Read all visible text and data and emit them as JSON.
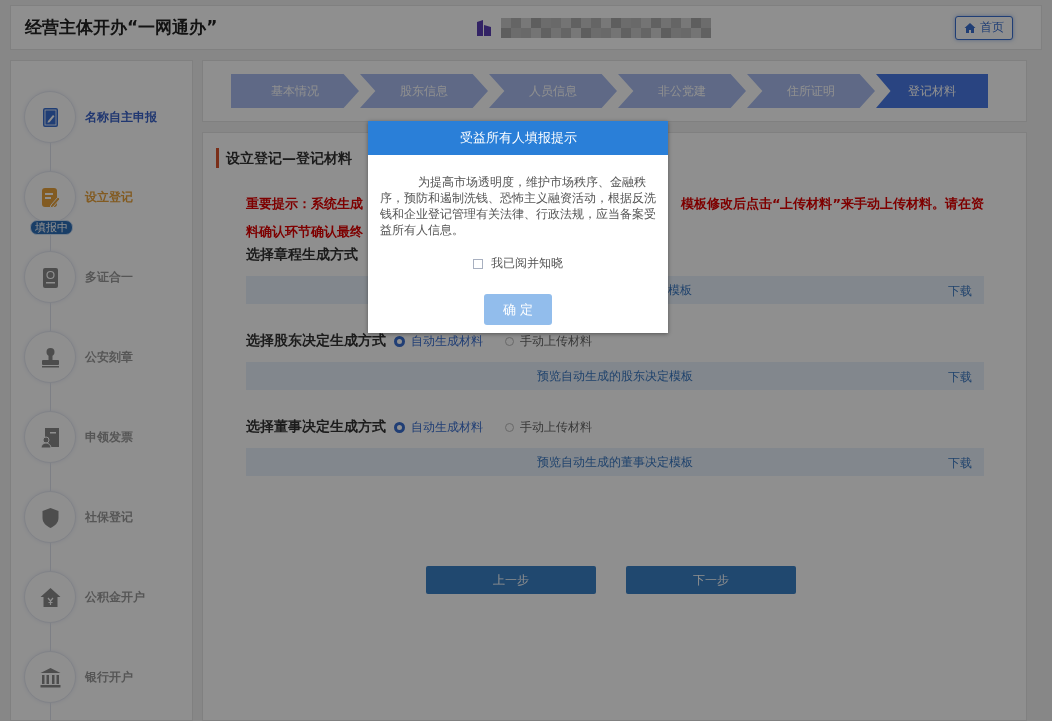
{
  "header": {
    "title": "经营主体开办“一网通办”",
    "home_button": "首页"
  },
  "sidebar": {
    "items": [
      {
        "label": "名称自主申报",
        "completed": true,
        "selected": false
      },
      {
        "label": "设立登记",
        "completed": false,
        "selected": true,
        "badge": "填报中"
      },
      {
        "label": "多证合一",
        "completed": false,
        "selected": false
      },
      {
        "label": "公安刻章",
        "completed": false,
        "selected": false
      },
      {
        "label": "申领发票",
        "completed": false,
        "selected": false
      },
      {
        "label": "社保登记",
        "completed": false,
        "selected": false
      },
      {
        "label": "公积金开户",
        "completed": false,
        "selected": false
      },
      {
        "label": "银行开户",
        "completed": false,
        "selected": false
      }
    ]
  },
  "steps": [
    {
      "label": "基本情况",
      "selected": false
    },
    {
      "label": "股东信息",
      "selected": false
    },
    {
      "label": "人员信息",
      "selected": false
    },
    {
      "label": "非公党建",
      "selected": false
    },
    {
      "label": "住所证明",
      "selected": false
    },
    {
      "label": "登记材料",
      "selected": true
    }
  ],
  "main": {
    "title": "设立登记—登记材料",
    "notice_lines": [
      {
        "start": "重要提示：系统生成",
        "end": "模板修改后点击“上传材料”来手动上传材料。请在资"
      },
      {
        "start": "料确认环节确认最终"
      }
    ],
    "sections": [
      {
        "label": "选择章程生成方式",
        "template": {
          "text": "模板",
          "download": "下载"
        }
      },
      {
        "label": "选择股东决定生成方式",
        "options": [
          {
            "label": "自动生成材料",
            "selected": true
          },
          {
            "label": "手动上传材料",
            "selected": false
          }
        ],
        "template": {
          "text": "预览自动生成的股东决定模板",
          "download": "下载"
        }
      },
      {
        "label": "选择董事决定生成方式",
        "options": [
          {
            "label": "自动生成材料",
            "selected": true
          },
          {
            "label": "手动上传材料",
            "selected": false
          }
        ],
        "template": {
          "text": "预览自动生成的董事决定模板",
          "download": "下载"
        }
      }
    ],
    "buttons": [
      "上一步",
      "下一步"
    ]
  },
  "dialog": {
    "title": "受益所有人填报提示",
    "message": "为提高市场透明度，维护市场秩序、金融秩序，预防和遏制洗钱、恐怖主义融资活动，根据反洗钱和企业登记管理有关法律、行政法规，应当备案受益所有人信息。",
    "checkbox": {
      "label": "我已阅并知晓",
      "checked": false
    },
    "confirm": "确 定"
  }
}
